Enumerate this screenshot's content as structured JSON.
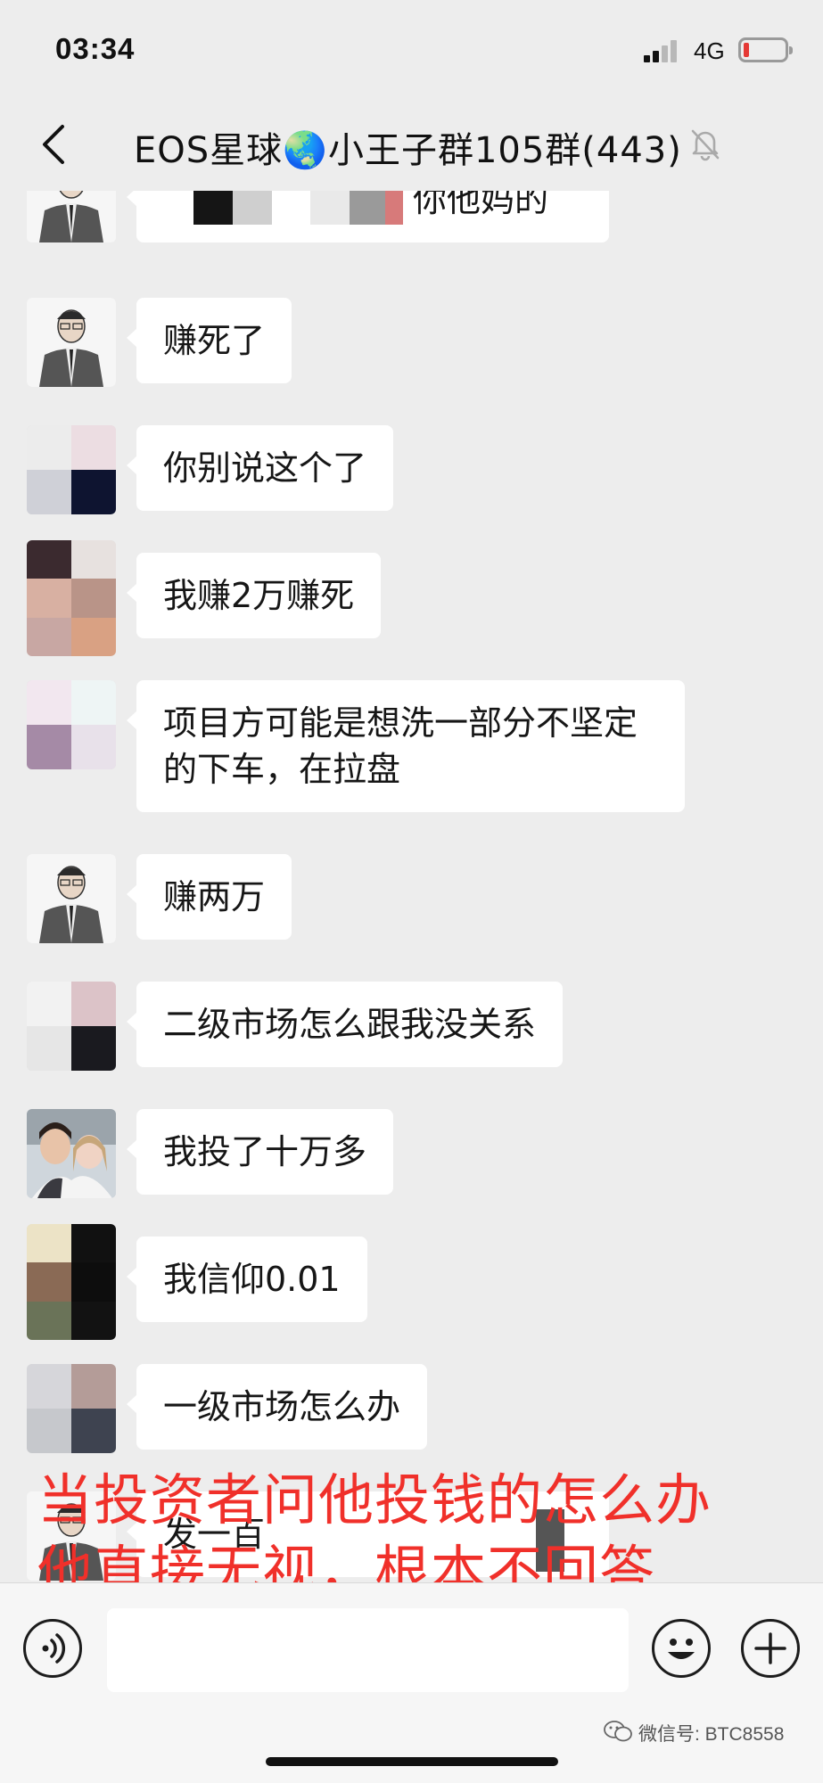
{
  "status_bar": {
    "time": "03:34",
    "network": "4G",
    "battery_color": "#e53935",
    "battery_level": 0.12
  },
  "header": {
    "title": "EOS星球🌏小王子群105群(443)",
    "back_icon": "chevron-left-icon",
    "mute_icon": "bell-muted-icon"
  },
  "messages": [
    {
      "text": "你他妈的",
      "avatar": "man-in-suit-illustration"
    },
    {
      "text": "赚死了",
      "avatar": "man-in-suit-illustration"
    },
    {
      "text": "你别说这个了",
      "avatar": "blurred-avatar"
    },
    {
      "text": "我赚2万赚死",
      "avatar": "blurred-avatar"
    },
    {
      "text": "项目方可能是想洗一部分不坚定的下车，在拉盘",
      "avatar": "blurred-avatar"
    },
    {
      "text": "赚两万",
      "avatar": "man-in-suit-illustration"
    },
    {
      "text": "二级市场怎么跟我没关系",
      "avatar": "blurred-avatar"
    },
    {
      "text": "我投了十万多",
      "avatar": "couple-photo"
    },
    {
      "text": "我信仰0.01",
      "avatar": "blurred-avatar"
    },
    {
      "text": "一级市场怎么办",
      "avatar": "blurred-avatar"
    },
    {
      "text": "发一百",
      "avatar": "man-in-suit-illustration"
    }
  ],
  "annotation": {
    "line1": "当投资者问他投钱的怎么办",
    "line2": "他直接无视，根本不回答",
    "color": "#f0302a"
  },
  "input_bar": {
    "voice_icon": "voice-icon",
    "emoji_icon": "smiley-icon",
    "plus_icon": "plus-icon",
    "input_value": ""
  },
  "watermark": {
    "text": "微信号: BTC8558"
  },
  "colors": {
    "background": "#ededed",
    "bubble": "#ffffff",
    "text": "#161616"
  }
}
